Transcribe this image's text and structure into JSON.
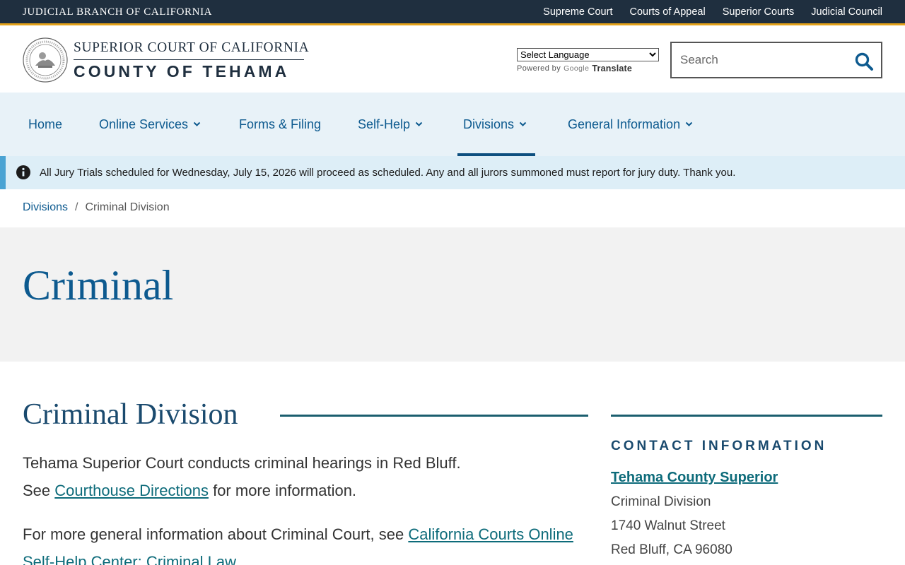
{
  "topbar": {
    "title": "JUDICIAL BRANCH OF CALIFORNIA",
    "links": [
      "Supreme Court",
      "Courts of Appeal",
      "Superior Courts",
      "Judicial Council"
    ]
  },
  "header": {
    "brand_top": "SUPERIOR COURT OF CALIFORNIA",
    "brand_bottom": "COUNTY OF TEHAMA",
    "seal_icon": "california-judicial-seal-icon",
    "translate": {
      "select_value": "Select Language",
      "powered_by": "Powered by",
      "google": "Google",
      "translate": "Translate"
    },
    "search": {
      "placeholder": "Search",
      "icon": "search-icon"
    }
  },
  "nav": {
    "items": [
      {
        "label": "Home",
        "dropdown": false
      },
      {
        "label": "Online Services",
        "dropdown": true
      },
      {
        "label": "Forms & Filing",
        "dropdown": false
      },
      {
        "label": "Self-Help",
        "dropdown": true
      },
      {
        "label": "Divisions",
        "dropdown": true,
        "active": true
      },
      {
        "label": "General Information",
        "dropdown": true
      }
    ]
  },
  "alert": {
    "icon": "info-icon",
    "text": "All Jury Trials scheduled for Wednesday, July 15, 2026 will proceed as scheduled.  Any and all jurors summoned must report for jury duty. Thank you."
  },
  "breadcrumb": {
    "items": [
      "Divisions",
      "Criminal Division"
    ],
    "separator": "/"
  },
  "page": {
    "title": "Criminal"
  },
  "main": {
    "heading": "Criminal Division",
    "p1_text": "Tehama Superior Court conducts criminal hearings in Red Bluff.",
    "p1_see": "See",
    "p1_link": "Courthouse Directions",
    "p1_after": "for more information.",
    "p2_text": "For more general information about Criminal Court, see",
    "p2_link": "California Courts Online Self-Help Center: Criminal Law"
  },
  "contact": {
    "heading": "CONTACT INFORMATION",
    "name": "Tehama County Superior",
    "lines": [
      "Criminal Division",
      "1740 Walnut Street",
      "Red Bluff, CA  96080"
    ]
  },
  "colors": {
    "topbar_bg": "#1f2f3f",
    "accent_gold": "#e3a21a",
    "link_blue": "#0d5a8f",
    "nav_bg": "#e8f2f8",
    "alert_bg": "#ddeef7",
    "teal_link": "#0d6b7a"
  }
}
